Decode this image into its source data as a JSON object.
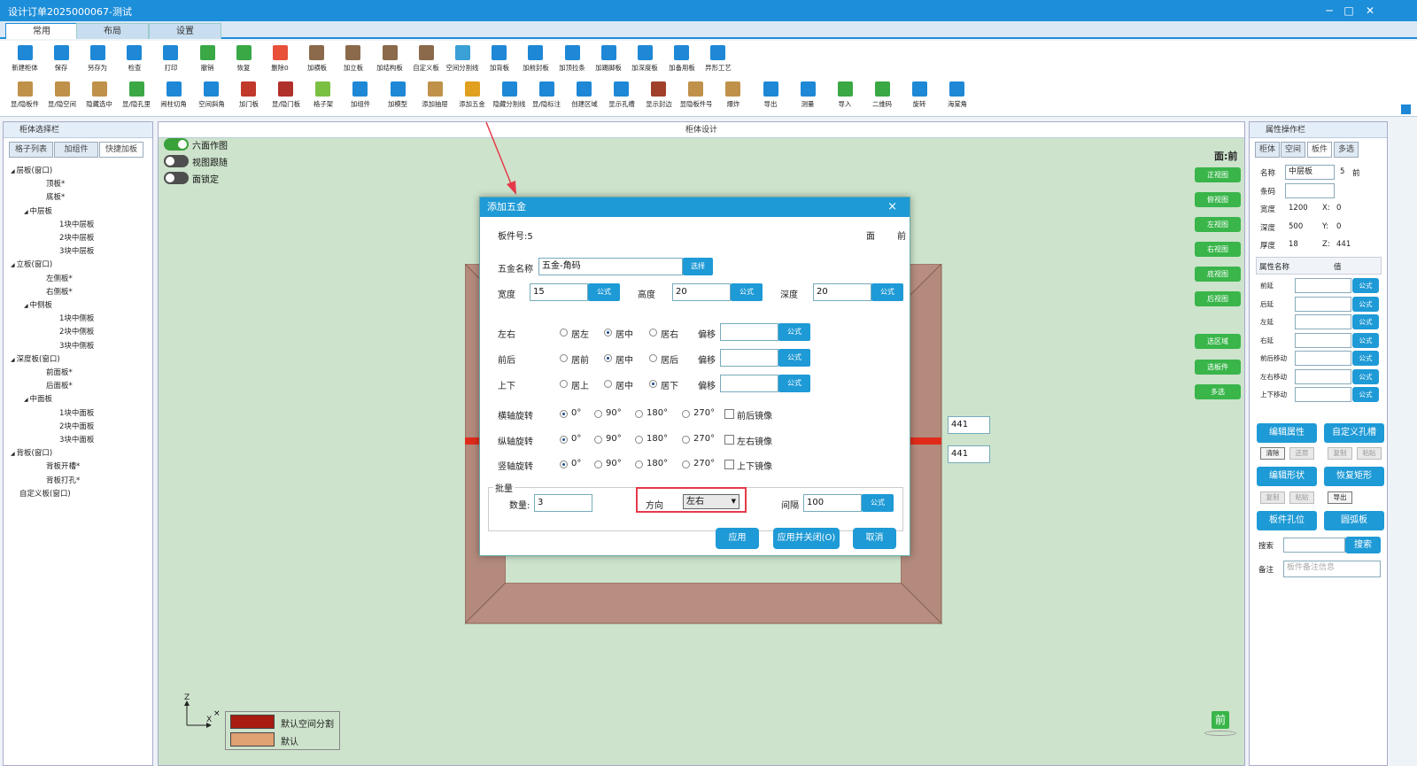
{
  "window": {
    "title": "设计订单2025000067-测试"
  },
  "ribbon_tabs": [
    "常用",
    "布局",
    "设置"
  ],
  "toolbar_row1": [
    "新建柜体",
    "保存",
    "另存为",
    "检查",
    "打印",
    "撤销",
    "恢复",
    "删除0",
    "加横板",
    "加立板",
    "加结构板",
    "自定义板",
    "空间分割线",
    "加背板",
    "加前封板",
    "加顶拉条",
    "加踢脚板",
    "加深度板",
    "加备用板",
    "异形工艺"
  ],
  "toolbar_row2": [
    "显/隐板件",
    "显/隐空间",
    "隐藏选中",
    "显/隐孔里",
    "闹柱切角",
    "空间斜角",
    "加门板",
    "显/隐门板",
    "格子架",
    "加组件",
    "加模型",
    "添加抽屉",
    "添加五金",
    "隐藏分割线",
    "显/隐标注",
    "创建区域",
    "显示孔槽",
    "显示封边",
    "显隐板件号",
    "爆炸",
    "导出",
    "测量",
    "导入",
    "二维码",
    "旋转",
    "海棠角"
  ],
  "left_panel": {
    "title": "柜体选择栏",
    "tabs": [
      "格子列表",
      "加组件",
      "快捷加板"
    ],
    "tree": [
      "层板(窗口)",
      "顶板*",
      "底板*",
      "中层板",
      "1块中层板",
      "2块中层板",
      "3块中层板",
      "立板(窗口)",
      "左侧板*",
      "右侧板*",
      "中侧板",
      "1块中侧板",
      "2块中侧板",
      "3块中侧板",
      "深度板(窗口)",
      "前面板*",
      "后面板*",
      "中面板",
      "1块中面板",
      "2块中面板",
      "3块中面板",
      "背板(窗口)",
      "背板开槽*",
      "背板打孔*",
      "自定义板(窗口)"
    ]
  },
  "canvas": {
    "title": "柜体设计",
    "toggles": [
      {
        "label": "六面作图",
        "on": true
      },
      {
        "label": "视图跟随",
        "on": false
      },
      {
        "label": "面锁定",
        "on": false
      }
    ],
    "view_label": "面:前",
    "view_buttons": [
      "正视图",
      "俯视图",
      "左视图",
      "右视图",
      "底视图",
      "后视图",
      "选区域",
      "选板件",
      "多选"
    ],
    "dimension_values": [
      "441",
      "441"
    ],
    "legend": [
      "默认空间分割",
      "默认"
    ],
    "axis_labels": {
      "z": "Z",
      "x": "X"
    },
    "face_badge": "前",
    "colors": {
      "background": "#cde3cc",
      "board": "#b38d7f",
      "divider": "#e02a1a",
      "accent": "#1e9ad6"
    }
  },
  "dialog": {
    "title": "添加五金",
    "close": "×",
    "part_no": "板件号:5",
    "face_label": "面",
    "face_value": "前",
    "name_label": "五金名称",
    "name_value": "五金-角码",
    "select_btn": "选择",
    "formula_btn": "公式",
    "width_label": "宽度",
    "width_value": "15",
    "height_label": "高度",
    "height_value": "20",
    "depth_label": "深度",
    "depth_value": "20",
    "pos_rows": [
      {
        "label": "左右",
        "options": [
          "居左",
          "居中",
          "居右"
        ],
        "selected": 1
      },
      {
        "label": "前后",
        "options": [
          "居前",
          "居中",
          "居后"
        ],
        "selected": 1
      },
      {
        "label": "上下",
        "options": [
          "居上",
          "居中",
          "居下"
        ],
        "selected": 2
      }
    ],
    "offset_label": "偏移",
    "rot_rows": [
      {
        "label": "横轴旋转",
        "mirror": "前后镜像"
      },
      {
        "label": "纵轴旋转",
        "mirror": "左右镜像"
      },
      {
        "label": "竖轴旋转",
        "mirror": "上下镜像"
      }
    ],
    "rot_options": [
      "0°",
      "90°",
      "180°",
      "270°"
    ],
    "batch_label": "批量",
    "count_label": "数量:",
    "count_value": "3",
    "direction_label": "方向",
    "direction_value": "左右",
    "interval_label": "间隔",
    "interval_value": "100",
    "apply": "应用",
    "apply_close": "应用并关闭(O)",
    "cancel": "取消"
  },
  "right_panel": {
    "title": "属性操作栏",
    "tabs": [
      "柜体",
      "空间",
      "板件",
      "多选"
    ],
    "name_label": "名称",
    "name_value": "中层板",
    "num": "5",
    "face": "前",
    "code_label": "条码",
    "width_label": "宽度",
    "width_value": "1200",
    "x_label": "X:",
    "x_value": "0",
    "depth_label": "深度",
    "depth_value": "500",
    "y_label": "Y:",
    "y_value": "0",
    "thick_label": "厚度",
    "thick_value": "18",
    "z_label": "Z:",
    "z_value": "441",
    "table_header": [
      "属性名称",
      "值"
    ],
    "attr_rows": [
      "前延",
      "后延",
      "左延",
      "右延",
      "前后移动",
      "左右移动",
      "上下移动"
    ],
    "formula_btn": "公式",
    "big_buttons": [
      [
        "编辑属性",
        "自定义孔槽"
      ],
      [
        "编辑形状",
        "恢复矩形"
      ],
      [
        "板件孔位",
        "圆弧板"
      ]
    ],
    "small_row1": [
      "清除",
      "还原",
      "复制",
      "粘贴"
    ],
    "small_row2": [
      "复制",
      "粘贴",
      "导出"
    ],
    "search_label": "搜索",
    "search_btn": "搜索",
    "note_label": "备注",
    "note_placeholder": "板件备注信息"
  }
}
